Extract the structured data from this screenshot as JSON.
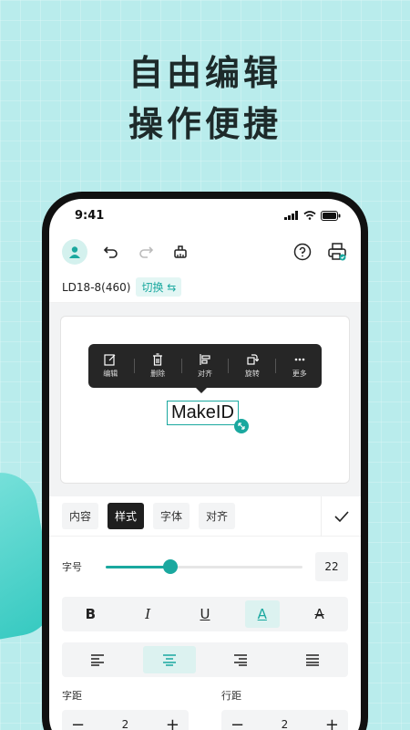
{
  "headline": {
    "line1": "自由编辑",
    "line2": "操作便捷"
  },
  "status": {
    "time": "9:41"
  },
  "subbar": {
    "model": "LD18-8(460)",
    "switch_label": "切换 ⇆"
  },
  "context_menu": {
    "items": [
      {
        "label": "编辑",
        "icon": "edit-icon"
      },
      {
        "label": "删除",
        "icon": "trash-icon"
      },
      {
        "label": "对齐",
        "icon": "align-icon"
      },
      {
        "label": "旋转",
        "icon": "rotate-icon"
      },
      {
        "label": "更多",
        "icon": "more-icon"
      }
    ]
  },
  "canvas": {
    "label_text": "MakeID"
  },
  "tabs": [
    {
      "label": "内容",
      "active": false
    },
    {
      "label": "样式",
      "active": true
    },
    {
      "label": "字体",
      "active": false
    },
    {
      "label": "对齐",
      "active": false
    }
  ],
  "font_size": {
    "label": "字号",
    "value": "22",
    "level": 0.33
  },
  "style_buttons": [
    "B",
    "I",
    "U",
    "A",
    "A"
  ],
  "spacing": {
    "letter": {
      "label": "字距",
      "value": "2"
    },
    "line": {
      "label": "行距",
      "value": "2"
    }
  },
  "colors": {
    "accent": "#1aa89f",
    "background": "#b9ecec"
  }
}
